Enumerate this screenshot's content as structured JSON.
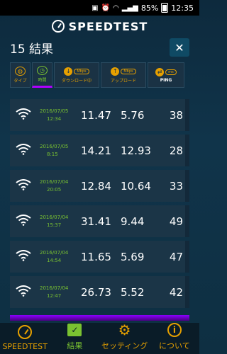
{
  "status_bar": {
    "battery": "85%",
    "time": "12:35"
  },
  "header": {
    "title": "SPEEDTEST"
  },
  "results": {
    "count_label": "15 結果"
  },
  "sort": {
    "type_label": "タイプ",
    "time_label": "時間",
    "download_label": "ダウンロード中",
    "download_unit": "Mbps",
    "upload_label": "アップロード",
    "upload_unit": "Mbps",
    "ping_label": "PING",
    "ping_unit": "ms"
  },
  "rows": [
    {
      "date": "2016/07/05",
      "time": "12:34",
      "download": "11.47",
      "upload": "5.76",
      "ping": "38"
    },
    {
      "date": "2016/07/05",
      "time": "8:15",
      "download": "14.21",
      "upload": "12.93",
      "ping": "28"
    },
    {
      "date": "2016/07/04",
      "time": "20:05",
      "download": "12.84",
      "upload": "10.64",
      "ping": "33"
    },
    {
      "date": "2016/07/04",
      "time": "15:37",
      "download": "31.41",
      "upload": "9.44",
      "ping": "49"
    },
    {
      "date": "2016/07/04",
      "time": "14:54",
      "download": "11.65",
      "upload": "5.69",
      "ping": "47"
    },
    {
      "date": "2016/07/04",
      "time": "12:47",
      "download": "26.73",
      "upload": "5.52",
      "ping": "42"
    }
  ],
  "nav": {
    "speedtest": "SPEEDTEST",
    "results": "結果",
    "settings": "セッティング",
    "about": "について"
  },
  "colors": {
    "accent": "#e6a000",
    "active": "#7ac231",
    "highlight": "#b000ff"
  }
}
